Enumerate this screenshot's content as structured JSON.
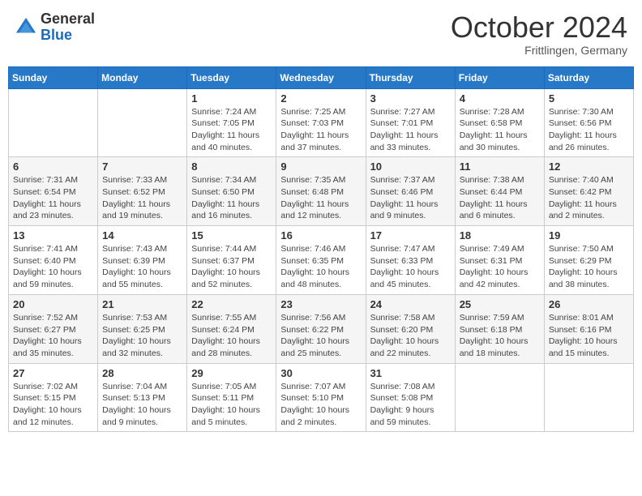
{
  "header": {
    "logo_general": "General",
    "logo_blue": "Blue",
    "month_title": "October 2024",
    "subtitle": "Frittlingen, Germany"
  },
  "days_of_week": [
    "Sunday",
    "Monday",
    "Tuesday",
    "Wednesday",
    "Thursday",
    "Friday",
    "Saturday"
  ],
  "weeks": [
    [
      {
        "day": "",
        "info": ""
      },
      {
        "day": "",
        "info": ""
      },
      {
        "day": "1",
        "info": "Sunrise: 7:24 AM\nSunset: 7:05 PM\nDaylight: 11 hours and 40 minutes."
      },
      {
        "day": "2",
        "info": "Sunrise: 7:25 AM\nSunset: 7:03 PM\nDaylight: 11 hours and 37 minutes."
      },
      {
        "day": "3",
        "info": "Sunrise: 7:27 AM\nSunset: 7:01 PM\nDaylight: 11 hours and 33 minutes."
      },
      {
        "day": "4",
        "info": "Sunrise: 7:28 AM\nSunset: 6:58 PM\nDaylight: 11 hours and 30 minutes."
      },
      {
        "day": "5",
        "info": "Sunrise: 7:30 AM\nSunset: 6:56 PM\nDaylight: 11 hours and 26 minutes."
      }
    ],
    [
      {
        "day": "6",
        "info": "Sunrise: 7:31 AM\nSunset: 6:54 PM\nDaylight: 11 hours and 23 minutes."
      },
      {
        "day": "7",
        "info": "Sunrise: 7:33 AM\nSunset: 6:52 PM\nDaylight: 11 hours and 19 minutes."
      },
      {
        "day": "8",
        "info": "Sunrise: 7:34 AM\nSunset: 6:50 PM\nDaylight: 11 hours and 16 minutes."
      },
      {
        "day": "9",
        "info": "Sunrise: 7:35 AM\nSunset: 6:48 PM\nDaylight: 11 hours and 12 minutes."
      },
      {
        "day": "10",
        "info": "Sunrise: 7:37 AM\nSunset: 6:46 PM\nDaylight: 11 hours and 9 minutes."
      },
      {
        "day": "11",
        "info": "Sunrise: 7:38 AM\nSunset: 6:44 PM\nDaylight: 11 hours and 6 minutes."
      },
      {
        "day": "12",
        "info": "Sunrise: 7:40 AM\nSunset: 6:42 PM\nDaylight: 11 hours and 2 minutes."
      }
    ],
    [
      {
        "day": "13",
        "info": "Sunrise: 7:41 AM\nSunset: 6:40 PM\nDaylight: 10 hours and 59 minutes."
      },
      {
        "day": "14",
        "info": "Sunrise: 7:43 AM\nSunset: 6:39 PM\nDaylight: 10 hours and 55 minutes."
      },
      {
        "day": "15",
        "info": "Sunrise: 7:44 AM\nSunset: 6:37 PM\nDaylight: 10 hours and 52 minutes."
      },
      {
        "day": "16",
        "info": "Sunrise: 7:46 AM\nSunset: 6:35 PM\nDaylight: 10 hours and 48 minutes."
      },
      {
        "day": "17",
        "info": "Sunrise: 7:47 AM\nSunset: 6:33 PM\nDaylight: 10 hours and 45 minutes."
      },
      {
        "day": "18",
        "info": "Sunrise: 7:49 AM\nSunset: 6:31 PM\nDaylight: 10 hours and 42 minutes."
      },
      {
        "day": "19",
        "info": "Sunrise: 7:50 AM\nSunset: 6:29 PM\nDaylight: 10 hours and 38 minutes."
      }
    ],
    [
      {
        "day": "20",
        "info": "Sunrise: 7:52 AM\nSunset: 6:27 PM\nDaylight: 10 hours and 35 minutes."
      },
      {
        "day": "21",
        "info": "Sunrise: 7:53 AM\nSunset: 6:25 PM\nDaylight: 10 hours and 32 minutes."
      },
      {
        "day": "22",
        "info": "Sunrise: 7:55 AM\nSunset: 6:24 PM\nDaylight: 10 hours and 28 minutes."
      },
      {
        "day": "23",
        "info": "Sunrise: 7:56 AM\nSunset: 6:22 PM\nDaylight: 10 hours and 25 minutes."
      },
      {
        "day": "24",
        "info": "Sunrise: 7:58 AM\nSunset: 6:20 PM\nDaylight: 10 hours and 22 minutes."
      },
      {
        "day": "25",
        "info": "Sunrise: 7:59 AM\nSunset: 6:18 PM\nDaylight: 10 hours and 18 minutes."
      },
      {
        "day": "26",
        "info": "Sunrise: 8:01 AM\nSunset: 6:16 PM\nDaylight: 10 hours and 15 minutes."
      }
    ],
    [
      {
        "day": "27",
        "info": "Sunrise: 7:02 AM\nSunset: 5:15 PM\nDaylight: 10 hours and 12 minutes."
      },
      {
        "day": "28",
        "info": "Sunrise: 7:04 AM\nSunset: 5:13 PM\nDaylight: 10 hours and 9 minutes."
      },
      {
        "day": "29",
        "info": "Sunrise: 7:05 AM\nSunset: 5:11 PM\nDaylight: 10 hours and 5 minutes."
      },
      {
        "day": "30",
        "info": "Sunrise: 7:07 AM\nSunset: 5:10 PM\nDaylight: 10 hours and 2 minutes."
      },
      {
        "day": "31",
        "info": "Sunrise: 7:08 AM\nSunset: 5:08 PM\nDaylight: 9 hours and 59 minutes."
      },
      {
        "day": "",
        "info": ""
      },
      {
        "day": "",
        "info": ""
      }
    ]
  ]
}
